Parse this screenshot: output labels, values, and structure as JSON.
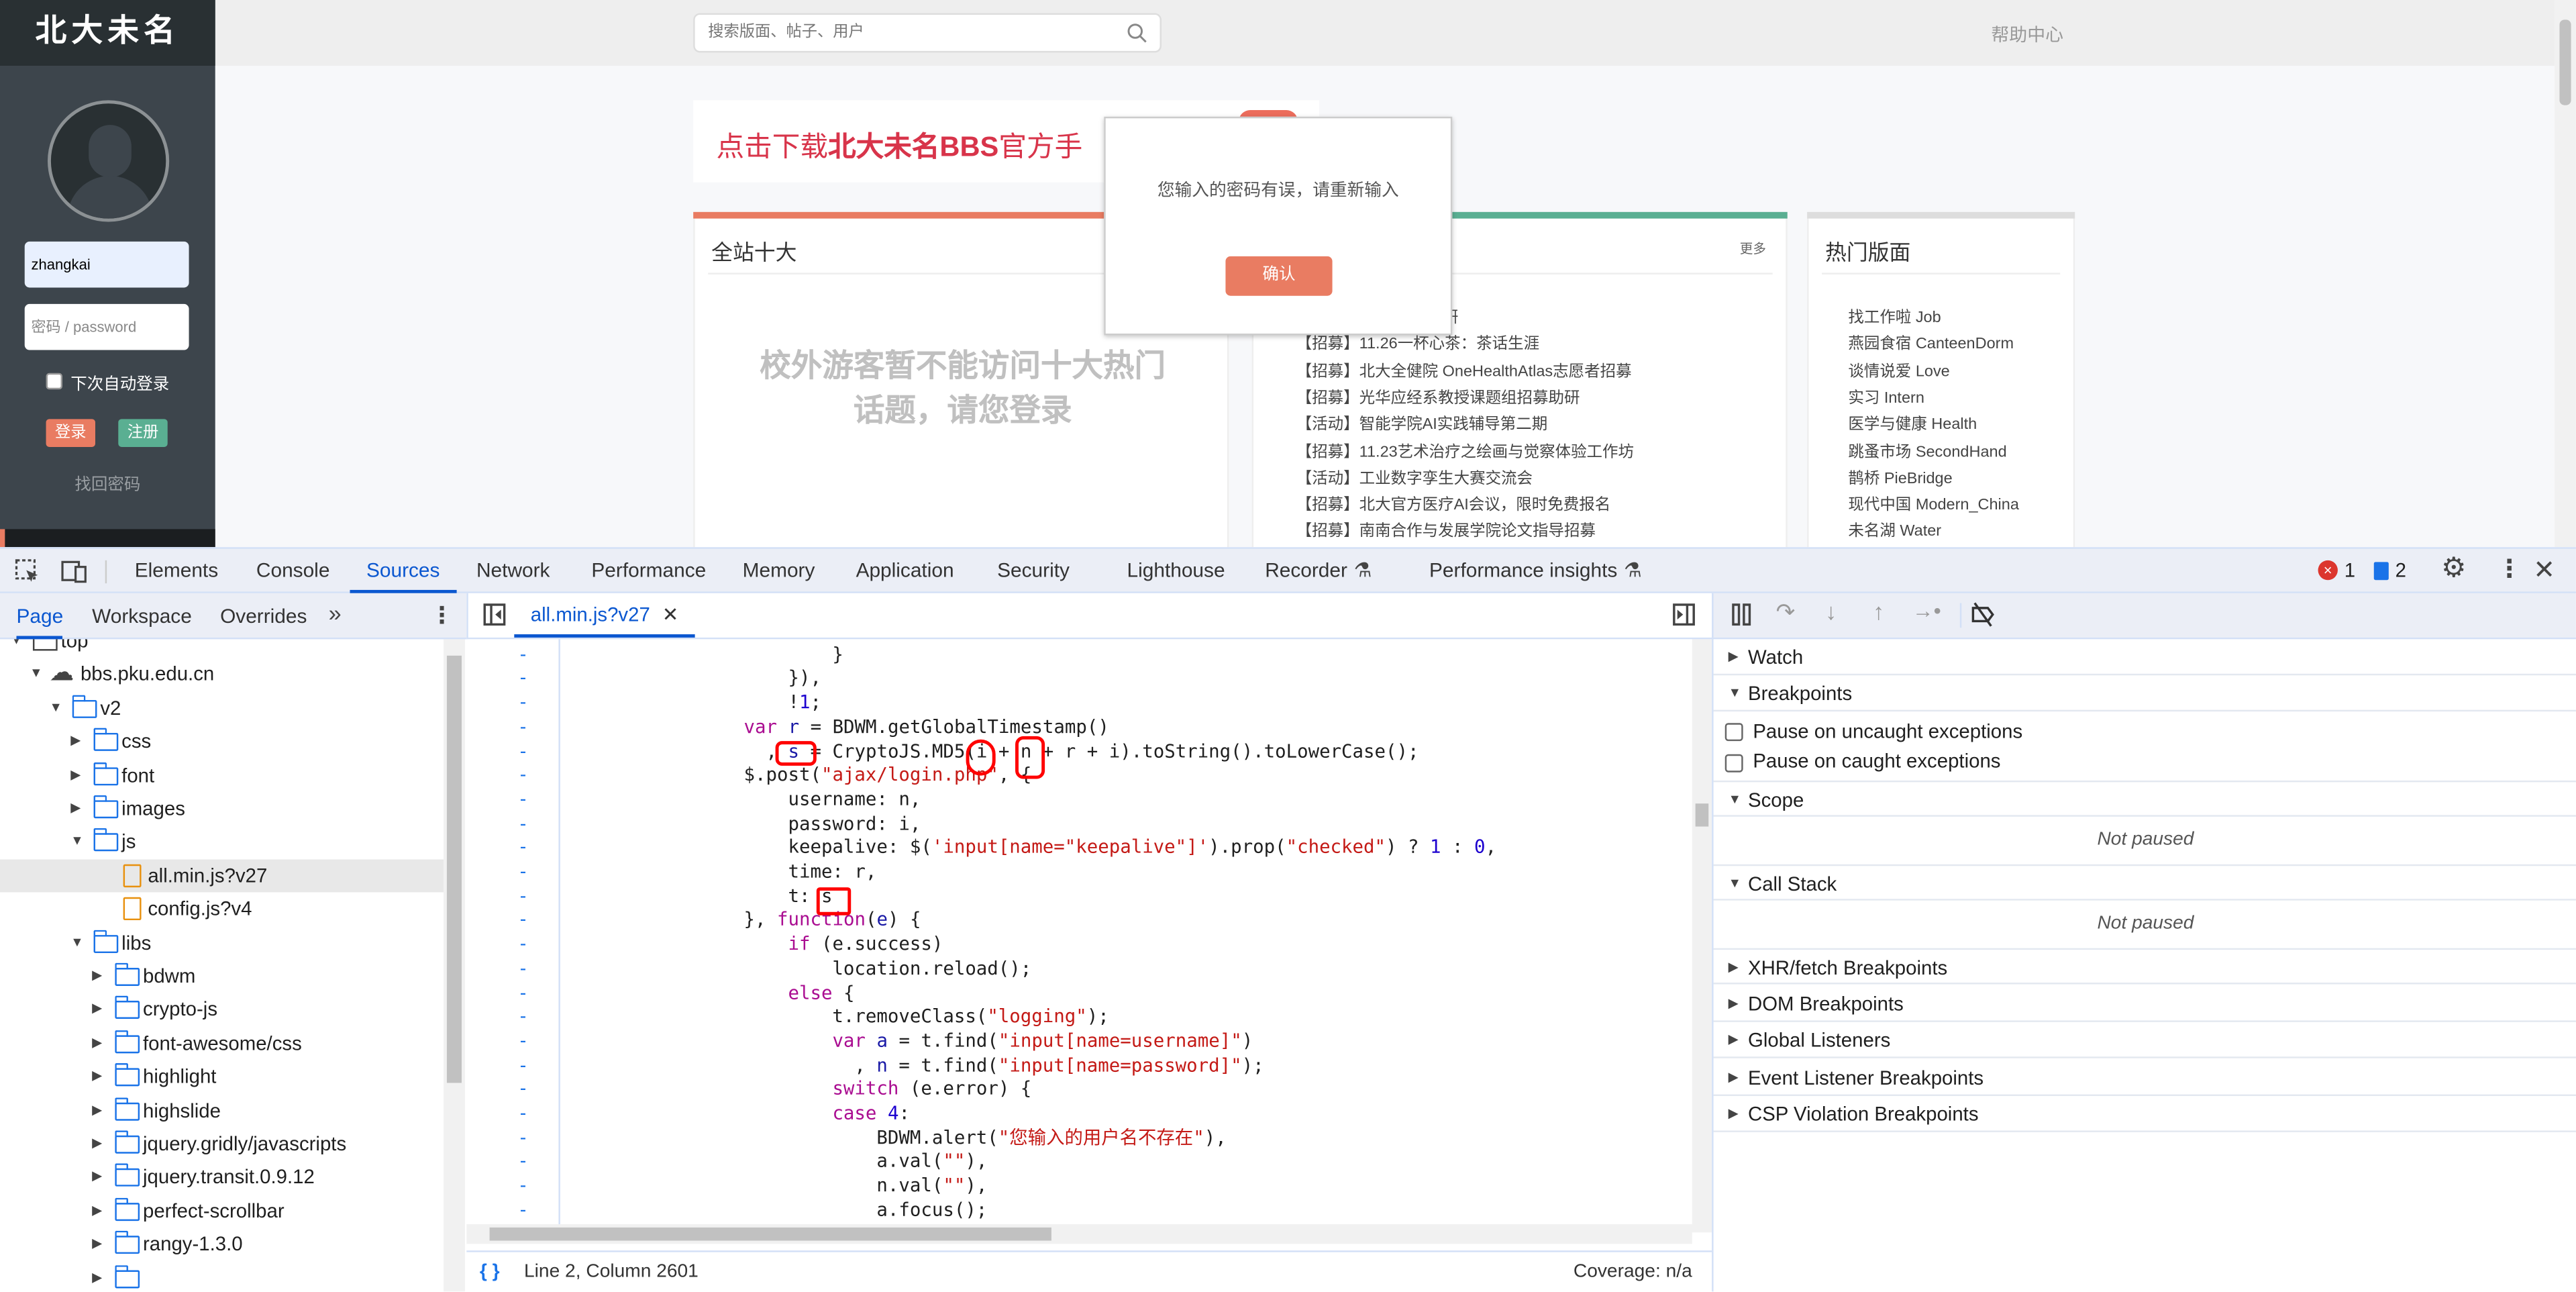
{
  "page": {
    "logo": "北大未名",
    "search_placeholder": "搜索版面、帖子、用户",
    "help_link": "帮助中心",
    "login": {
      "username_value": "zhangkai",
      "password_placeholder": "密码 / password",
      "auto_login_label": "下次自动登录",
      "auto_login_checked": false,
      "login_button": "登录",
      "register_button": "注册",
      "forgot_link": "找回密码"
    },
    "banner": {
      "text_pre": "点击下载",
      "text_bold": "北大未名BBS",
      "text_post": "官方手"
    },
    "top_ten": {
      "title": "全站十大",
      "notice_line1": "校外游客暂不能访问十大热门",
      "notice_line2": "话题，请您登录"
    },
    "news": {
      "more": "更多",
      "items": [
        "振兴研究院招募专著写作助研",
        "【招募】11.26一杯心茶：茶话生涯",
        "【招募】北大全健院 OneHealthAtlas志愿者招募",
        "【招募】光华应经系教授课题组招募助研",
        "【活动】智能学院AI实践辅导第二期",
        "【招募】11.23艺术治疗之绘画与觉察体验工作坊",
        "【活动】工业数字孪生大赛交流会",
        "【招募】北大官方医疗AI会议，限时免费报名",
        "【招募】南南合作与发展学院论文指导招募"
      ]
    },
    "hot_boards": {
      "title": "热门版面",
      "items": [
        "找工作啦 Job",
        "燕园食宿 CanteenDorm",
        "谈情说爱 Love",
        "实习 Intern",
        "医学与健康 Health",
        "跳蚤市场 SecondHand",
        "鹊桥 PieBridge",
        "现代中国 Modern_China",
        "未名湖 Water"
      ]
    },
    "modal": {
      "message": "您输入的密码有误，请重新输入",
      "confirm_button": "确认"
    },
    "colors": {
      "accent_orange": "#e97c62",
      "accent_green": "#5aaf92",
      "banner_red": "#d8344a"
    }
  },
  "devtools": {
    "tabs": [
      "Elements",
      "Console",
      "Sources",
      "Network",
      "Performance",
      "Memory",
      "Application",
      "Security",
      "Lighthouse",
      "Recorder",
      "Performance insights"
    ],
    "active_tab": "Sources",
    "error_count": "1",
    "message_count": "2",
    "navigator_tabs": [
      "Page",
      "Workspace",
      "Overrides"
    ],
    "navigator_more": "»",
    "open_file_tab": "all.min.js?v27",
    "tree": [
      {
        "label": "top",
        "depth": 0,
        "arrow": "open",
        "icon": "frame"
      },
      {
        "label": "bbs.pku.edu.cn",
        "depth": 1,
        "arrow": "open",
        "icon": "cloud"
      },
      {
        "label": "v2",
        "depth": 2,
        "arrow": "open",
        "icon": "folder"
      },
      {
        "label": "css",
        "depth": 3,
        "arrow": "closed",
        "icon": "folder"
      },
      {
        "label": "font",
        "depth": 3,
        "arrow": "closed",
        "icon": "folder"
      },
      {
        "label": "images",
        "depth": 3,
        "arrow": "closed",
        "icon": "folder"
      },
      {
        "label": "js",
        "depth": 3,
        "arrow": "open",
        "icon": "folder"
      },
      {
        "label": "all.min.js?v27",
        "depth": 4,
        "arrow": "none",
        "icon": "file",
        "selected": true
      },
      {
        "label": "config.js?v4",
        "depth": 4,
        "arrow": "none",
        "icon": "file"
      },
      {
        "label": "libs",
        "depth": 3,
        "arrow": "open",
        "icon": "folder"
      },
      {
        "label": "bdwm",
        "depth": 4,
        "arrow": "closed",
        "icon": "folder"
      },
      {
        "label": "crypto-js",
        "depth": 4,
        "arrow": "closed",
        "icon": "folder"
      },
      {
        "label": "font-awesome/css",
        "depth": 4,
        "arrow": "closed",
        "icon": "folder"
      },
      {
        "label": "highlight",
        "depth": 4,
        "arrow": "closed",
        "icon": "folder"
      },
      {
        "label": "highslide",
        "depth": 4,
        "arrow": "closed",
        "icon": "folder"
      },
      {
        "label": "jquery.gridly/javascripts",
        "depth": 4,
        "arrow": "closed",
        "icon": "folder"
      },
      {
        "label": "jquery.transit.0.9.12",
        "depth": 4,
        "arrow": "closed",
        "icon": "folder"
      },
      {
        "label": "perfect-scrollbar",
        "depth": 4,
        "arrow": "closed",
        "icon": "folder"
      },
      {
        "label": "rangy-1.3.0",
        "depth": 4,
        "arrow": "closed",
        "icon": "folder"
      },
      {
        "label": "",
        "depth": 4,
        "arrow": "closed",
        "icon": "folder"
      }
    ],
    "code_lines": [
      [
        [
          "p",
          "                            e.focus()"
        ]
      ],
      [
        [
          "p",
          "                        }"
        ]
      ],
      [
        [
          "p",
          "                    }),"
        ]
      ],
      [
        [
          "p",
          "                    !"
        ],
        [
          "num",
          "1"
        ],
        [
          "p",
          ";"
        ]
      ],
      [
        [
          "p",
          "                "
        ],
        [
          "kw",
          "var"
        ],
        [
          "p",
          " "
        ],
        [
          "def",
          "r"
        ],
        [
          "p",
          " = BDWM.getGlobalTimestamp()"
        ]
      ],
      [
        [
          "p",
          "                  , "
        ],
        [
          "def",
          "s"
        ],
        [
          "p",
          " = CryptoJS.MD5(i + n + r + i).toString().toLowerCase();"
        ]
      ],
      [
        [
          "p",
          "                $.post("
        ],
        [
          "str",
          "\"ajax/login.php\""
        ],
        [
          "p",
          ", {"
        ]
      ],
      [
        [
          "p",
          "                    username: n,"
        ]
      ],
      [
        [
          "p",
          "                    password: i,"
        ]
      ],
      [
        [
          "p",
          "                    keepalive: $("
        ],
        [
          "str",
          "'input[name=\"keepalive\"]'"
        ],
        [
          "p",
          ").prop("
        ],
        [
          "str",
          "\"checked\""
        ],
        [
          "p",
          ") ? "
        ],
        [
          "num",
          "1"
        ],
        [
          "p",
          " : "
        ],
        [
          "num",
          "0"
        ],
        [
          "p",
          ","
        ]
      ],
      [
        [
          "p",
          "                    time: r,"
        ]
      ],
      [
        [
          "p",
          "                    t: s"
        ]
      ],
      [
        [
          "p",
          "                }, "
        ],
        [
          "kw",
          "function"
        ],
        [
          "p",
          "("
        ],
        [
          "def",
          "e"
        ],
        [
          "p",
          ") {"
        ]
      ],
      [
        [
          "p",
          "                    "
        ],
        [
          "kw",
          "if"
        ],
        [
          "p",
          " (e.success)"
        ]
      ],
      [
        [
          "p",
          "                        location.reload();"
        ]
      ],
      [
        [
          "p",
          "                    "
        ],
        [
          "kw",
          "else"
        ],
        [
          "p",
          " {"
        ]
      ],
      [
        [
          "p",
          "                        t.removeClass("
        ],
        [
          "str",
          "\"logging\""
        ],
        [
          "p",
          ");"
        ]
      ],
      [
        [
          "p",
          "                        "
        ],
        [
          "kw",
          "var"
        ],
        [
          "p",
          " "
        ],
        [
          "def",
          "a"
        ],
        [
          "p",
          " = t.find("
        ],
        [
          "str",
          "\"input[name=username]\""
        ],
        [
          "p",
          ")"
        ]
      ],
      [
        [
          "p",
          "                          , "
        ],
        [
          "def",
          "n"
        ],
        [
          "p",
          " = t.find("
        ],
        [
          "str",
          "\"input[name=password]\""
        ],
        [
          "p",
          ");"
        ]
      ],
      [
        [
          "p",
          "                        "
        ],
        [
          "kw",
          "switch"
        ],
        [
          "p",
          " (e.error) {"
        ]
      ],
      [
        [
          "p",
          "                        "
        ],
        [
          "kw",
          "case"
        ],
        [
          "p",
          " "
        ],
        [
          "num",
          "4"
        ],
        [
          "p",
          ":"
        ]
      ],
      [
        [
          "p",
          "                            BDWM.alert("
        ],
        [
          "str",
          "\"您输入的用户名不存在\""
        ],
        [
          "p",
          "),"
        ]
      ],
      [
        [
          "p",
          "                            a.val("
        ],
        [
          "str",
          "\"\""
        ],
        [
          "p",
          "),"
        ]
      ],
      [
        [
          "p",
          "                            n.val("
        ],
        [
          "str",
          "\"\""
        ],
        [
          "p",
          "),"
        ]
      ],
      [
        [
          "p",
          "                            a.focus();"
        ]
      ]
    ],
    "line_marker": "-",
    "status": {
      "position": "Line 2, Column 2601",
      "coverage": "Coverage: n/a"
    },
    "debugger": {
      "watch": "Watch",
      "breakpoints": "Breakpoints",
      "pause_uncaught": "Pause on uncaught exceptions",
      "pause_caught": "Pause on caught exceptions",
      "scope": "Scope",
      "scope_status": "Not paused",
      "call_stack": "Call Stack",
      "call_stack_status": "Not paused",
      "collapsed_sections": [
        "XHR/fetch Breakpoints",
        "DOM Breakpoints",
        "Global Listeners",
        "Event Listener Breakpoints",
        "CSP Violation Breakpoints"
      ]
    }
  }
}
